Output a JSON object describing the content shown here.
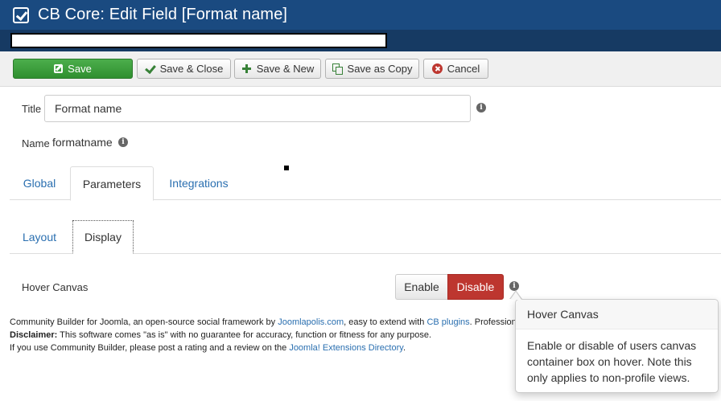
{
  "header": {
    "title": "CB Core: Edit Field [Format name]"
  },
  "toolbar": {
    "save": "Save",
    "save_close": "Save & Close",
    "save_new": "Save & New",
    "save_copy": "Save as Copy",
    "cancel": "Cancel"
  },
  "form": {
    "title_label": "Title",
    "title_value": "Format name",
    "name_label": "Name",
    "name_value": "formatname"
  },
  "tabs": [
    "Global",
    "Parameters",
    "Integrations"
  ],
  "subtabs": [
    "Layout",
    "Display"
  ],
  "hover_canvas": {
    "label": "Hover Canvas",
    "enable": "Enable",
    "disable": "Disable",
    "selected": "Disable"
  },
  "footer": {
    "line1_a": "Community Builder for Joomla, an open-source social framework by ",
    "line1_link1": "Joomlapolis.com",
    "line1_b": ", easy to extend with ",
    "line1_link2": "CB plugins",
    "line1_c": ". Professional",
    "disclaimer_label": "Disclaimer:",
    "disclaimer_text": " This software comes \"as is\" with no guarantee for accuracy, function or fitness for any purpose.",
    "line3_a": "If you use Community Builder, please post a rating and a review on the ",
    "line3_link": "Joomla! Extensions Directory",
    "line3_b": "."
  },
  "popover": {
    "title": "Hover Canvas",
    "body": "Enable or disable of users canvas container box on hover. Note this only applies to non-profile views."
  },
  "colors": {
    "header_bg": "#1a4a80",
    "save_green": "#3a9d3a",
    "disable_red": "#bd362f",
    "link_blue": "#2a6fb0"
  }
}
